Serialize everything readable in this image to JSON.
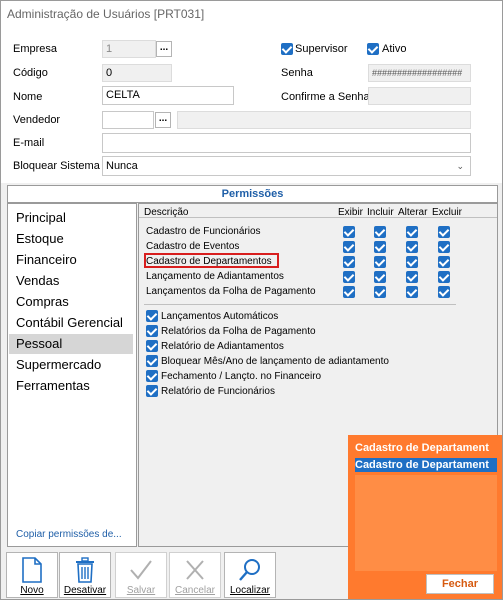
{
  "window": {
    "title": "Administração de Usuários [PRT031]"
  },
  "form": {
    "empresa_label": "Empresa",
    "empresa_value": "1",
    "codigo_label": "Código",
    "codigo_value": "0",
    "nome_label": "Nome",
    "nome_value": "CELTA",
    "vendedor_label": "Vendedor",
    "vendedor_value": "",
    "email_label": "E-mail",
    "email_value": "",
    "bloquear_label": "Bloquear Sistema",
    "bloquear_value": "Nunca",
    "supervisor_label": "Supervisor",
    "supervisor_checked": true,
    "ativo_label": "Ativo",
    "ativo_checked": true,
    "senha_label": "Senha",
    "senha_value": "##################",
    "confirme_label": "Confirme a Senha",
    "confirme_value": "",
    "dots_label": "..."
  },
  "permissions": {
    "title": "Permissões",
    "nav": [
      "Principal",
      "Estoque",
      "Financeiro",
      "Vendas",
      "Compras",
      "Contábil Gerencial",
      "Pessoal",
      "Supermercado",
      "Ferramentas"
    ],
    "active_nav": "Pessoal",
    "copy_link": "Copiar permissões de...",
    "headers": {
      "descricao": "Descrição",
      "exibir": "Exibir",
      "incluir": "Incluir",
      "alterar": "Alterar",
      "excluir": "Excluir"
    },
    "rows": [
      {
        "label": "Cadastro de Funcionários"
      },
      {
        "label": "Cadastro de Eventos"
      },
      {
        "label": "Cadastro de Departamentos"
      },
      {
        "label": "Lançamento de Adiantamentos"
      },
      {
        "label": "Lançamentos da Folha de Pagamento"
      }
    ],
    "options": [
      "Lançamentos Automáticos",
      "Relatórios da Folha de Pagamento",
      "Relatório de Adiantamentos",
      "Bloquear Mês/Ano de lançamento de adiantamento",
      "Fechamento / Lançto. no Financeiro",
      "Relatório de Funcionários"
    ]
  },
  "toolbar": {
    "novo": "Novo",
    "desativar": "Desativar",
    "salvar": "Salvar",
    "cancelar": "Cancelar",
    "localizar": "Localizar"
  },
  "tooltip": {
    "line1": "Cadastro de Departament",
    "line2": "Cadastro de Departament",
    "close": "Fechar"
  },
  "colors": {
    "accent": "#1f6fc4",
    "tooltip_bg": "#ff7a2e",
    "highlight": "#d81e1e"
  }
}
